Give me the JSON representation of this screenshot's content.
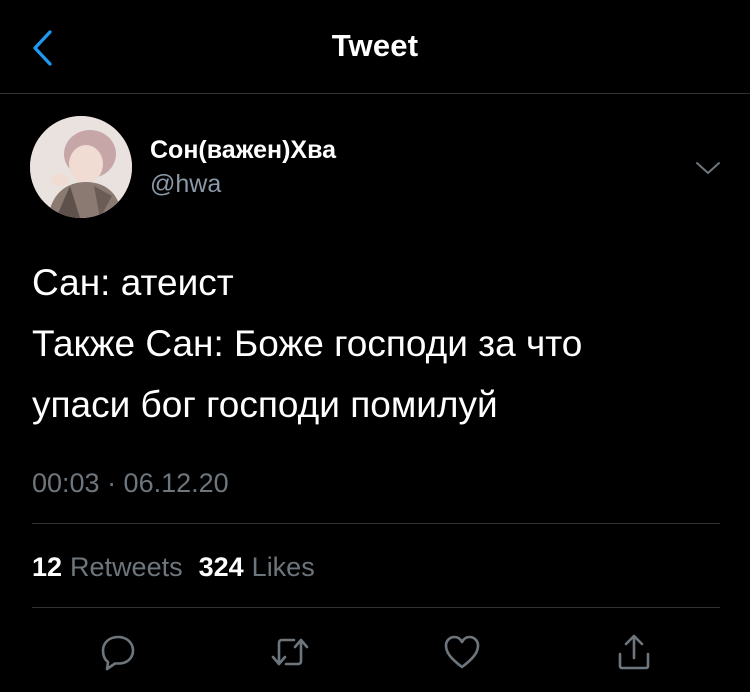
{
  "header": {
    "title": "Tweet",
    "back_icon": "chevron-left-icon"
  },
  "tweet": {
    "author": {
      "display_name": "Сон(важен)Хва",
      "handle": "@hwa"
    },
    "text_lines": [
      "Сан: атеист",
      "Также Сан: Боже господи за что",
      "упаси бог господи помилуй"
    ],
    "timestamp": "00:03 · 06.12.20",
    "stats": {
      "retweets_count": "12",
      "retweets_label": "Retweets",
      "likes_count": "324",
      "likes_label": "Likes"
    },
    "actions": [
      "reply-icon",
      "retweet-icon",
      "like-icon",
      "share-icon"
    ]
  },
  "colors": {
    "background": "#000000",
    "accent": "#1d9bf0",
    "secondary_text": "#6e767d",
    "divider": "#2f3336"
  }
}
